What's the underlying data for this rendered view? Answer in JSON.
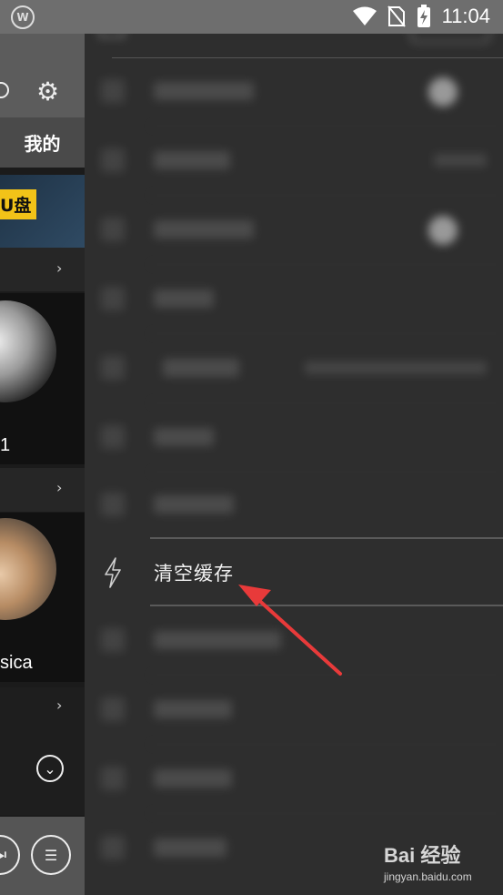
{
  "status_bar": {
    "app_icon": "app-logo-icon",
    "time": "11:04",
    "icons": [
      "wifi-icon",
      "no-sim-icon",
      "battery-charging-icon"
    ]
  },
  "left_panel": {
    "tab_label": "我的",
    "banner_text": "U盘",
    "profile_1_name": "1",
    "profile_2_name": "sica",
    "icons": [
      "search-icon",
      "gear-icon",
      "chevron-right-icon",
      "chevron-down-circle-icon",
      "skip-icon",
      "list-icon"
    ]
  },
  "drawer": {
    "highlighted_item": {
      "icon": "lightning-icon",
      "label": "清空缓存"
    },
    "annotation": {
      "color": "#e83a3a"
    }
  },
  "watermark": {
    "logo_text": "Bai 经验",
    "url": "jingyan.baidu.com"
  }
}
